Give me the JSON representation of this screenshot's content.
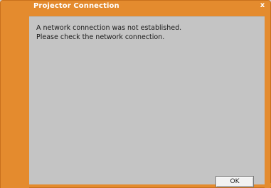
{
  "window": {
    "title": "Projector Connection",
    "close_label": "x"
  },
  "message": {
    "line1": "A network connection was not established.",
    "line2": "Please check the network connection."
  },
  "buttons": {
    "ok_label": "OK"
  },
  "colors": {
    "frame": "#e48b2e",
    "client": "#c4c4c4"
  }
}
